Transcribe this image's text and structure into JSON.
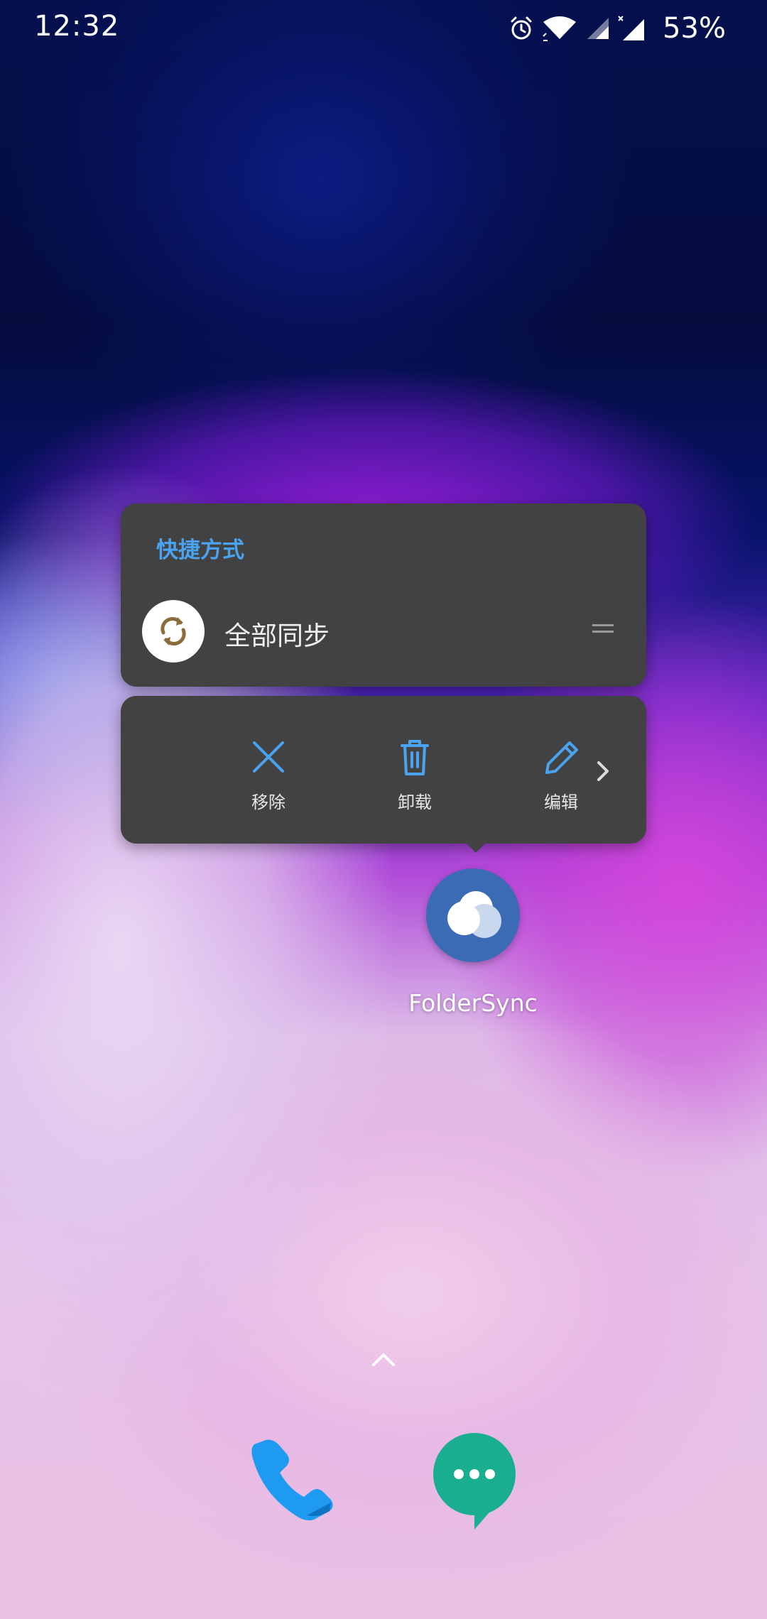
{
  "status_bar": {
    "time": "12:32",
    "battery": "53%",
    "icons": [
      "alarm-icon",
      "wifi-icon",
      "signal-icon",
      "signal-no-service-icon"
    ]
  },
  "shortcuts": {
    "header": "快捷方式",
    "items": [
      {
        "label": "全部同步",
        "icon": "sync-icon",
        "icon_color": "#8a6d3b"
      }
    ]
  },
  "actions": {
    "items": [
      {
        "label": "移除",
        "icon": "close-icon"
      },
      {
        "label": "卸载",
        "icon": "trash-icon"
      },
      {
        "label": "编辑",
        "icon": "pencil-icon"
      }
    ],
    "more_icon": "chevron-right-icon",
    "accent": "#4aa3f0"
  },
  "app": {
    "name": "FolderSync",
    "icon": "cloud-icon",
    "icon_bg": "#3b6bb5"
  },
  "dock": {
    "items": [
      {
        "icon": "phone-icon",
        "color": "#1e9bf0"
      },
      {
        "icon": "messages-icon",
        "color": "#1aae90"
      }
    ]
  }
}
